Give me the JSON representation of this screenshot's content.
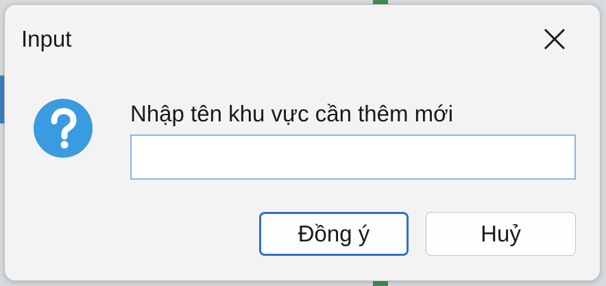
{
  "dialog": {
    "title": "Input",
    "prompt": "Nhập tên khu vực cần thêm mới",
    "input_value": "",
    "input_placeholder": "",
    "ok_label": "Đồng ý",
    "cancel_label": "Huỷ",
    "icons": {
      "close": "close-icon",
      "question": "question-icon"
    },
    "colors": {
      "question_icon": "#3a9be0",
      "ok_border": "#2f6fd0",
      "input_border": "#8ab4e6"
    }
  }
}
